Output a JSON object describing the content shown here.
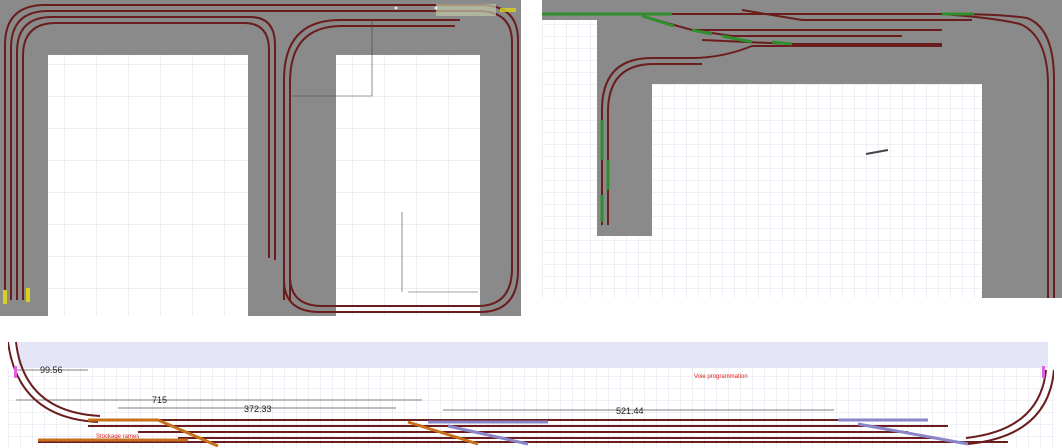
{
  "colors": {
    "baseboard": "#8a8a8a",
    "track_rail": "#6b1d1d",
    "track_rail_dark": "#3a0c0c",
    "turnout_green": "#2f8f2f",
    "track_orange": "#c8701a",
    "track_purple": "#8a86c8",
    "label_red": "#e02020",
    "label_yellow": "#d8d020",
    "sky_band": "#e4e6f7",
    "grid_line": "#d6d9e8"
  },
  "panel_c": {
    "dimensions": [
      "99.56",
      "715",
      "372.33",
      "521.44"
    ],
    "label_storage": "Stockage rames",
    "label_programming": "Voie programmation"
  }
}
